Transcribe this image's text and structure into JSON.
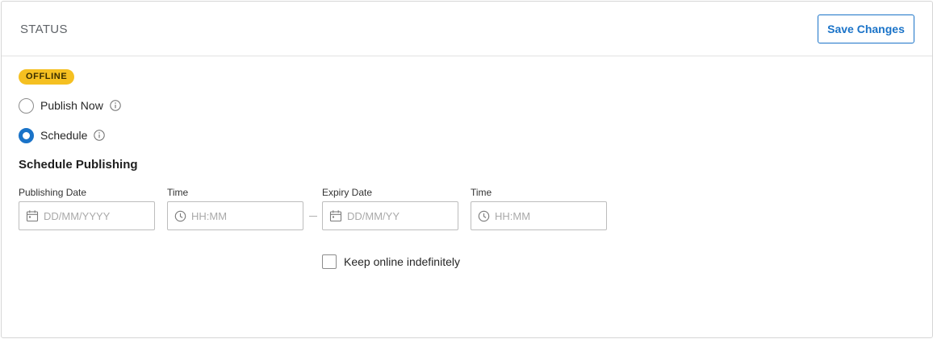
{
  "header": {
    "title": "STATUS",
    "save_label": "Save Changes"
  },
  "status_badge": {
    "text": "OFFLINE",
    "color": "#f5c021"
  },
  "publish_options": [
    {
      "label": "Publish Now",
      "selected": false,
      "icon": "info-icon"
    },
    {
      "label": "Schedule",
      "selected": true,
      "icon": "info-icon"
    }
  ],
  "schedule": {
    "title": "Schedule Publishing",
    "publishing_date": {
      "label": "Publishing Date",
      "placeholder": "DD/MM/YYYY",
      "value": "",
      "icon": "calendar-icon"
    },
    "publishing_time": {
      "label": "Time",
      "placeholder": "HH:MM",
      "value": "",
      "icon": "clock-icon"
    },
    "expiry_date": {
      "label": "Expiry Date",
      "placeholder": "DD/MM/YY",
      "value": "",
      "icon": "calendar-icon"
    },
    "expiry_time": {
      "label": "Time",
      "placeholder": "HH:MM",
      "value": "",
      "icon": "clock-icon"
    },
    "keep_online": {
      "label": "Keep online indefinitely",
      "checked": false
    }
  },
  "colors": {
    "accent": "#1a73c8",
    "badge": "#f5c021"
  }
}
